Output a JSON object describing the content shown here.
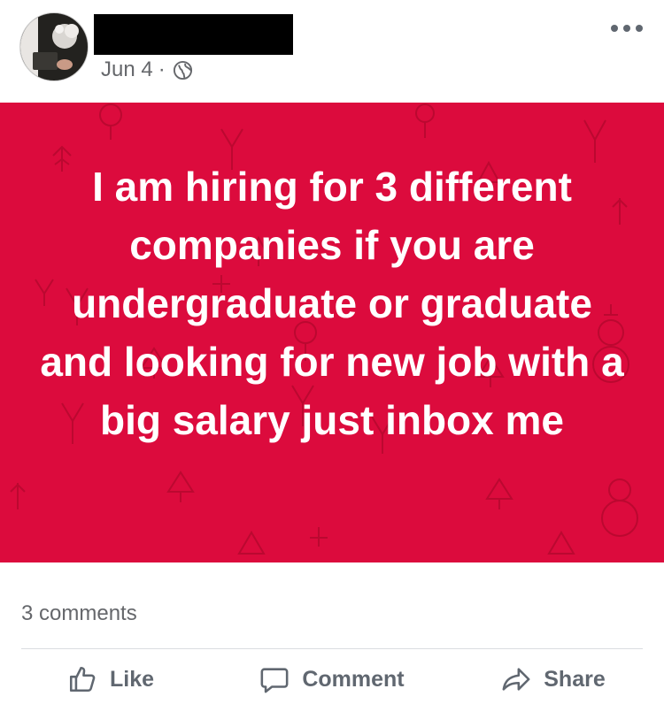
{
  "post": {
    "date": "Jun 4",
    "separator": "·",
    "audience_icon": "globe-icon",
    "body_text": "I am hiring for 3 different companies if you are undergraduate or graduate and looking for new job with a big salary just inbox me",
    "background_color": "#dc0b3d"
  },
  "stats": {
    "comments_label": "3 comments"
  },
  "actions": {
    "like_label": "Like",
    "comment_label": "Comment",
    "share_label": "Share"
  }
}
